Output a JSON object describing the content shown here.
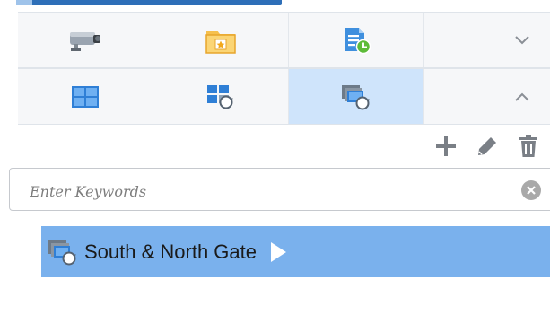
{
  "toolbar": {
    "row1": [
      "camera-icon",
      "favorites-folder-icon",
      "schedule-doc-icon",
      "chevron-down-icon"
    ],
    "row2": [
      "grid-view-icon",
      "custom-view-icon",
      "group-view-icon",
      "chevron-up-icon"
    ],
    "active_cell": "group-view-icon"
  },
  "actions": [
    "add-icon",
    "edit-icon",
    "delete-icon"
  ],
  "search": {
    "placeholder": "Enter Keywords",
    "value": ""
  },
  "tree": {
    "items": [
      {
        "label": "South & North Gate",
        "selected": true
      }
    ]
  },
  "colors": {
    "selected_bg": "#7ab1ed",
    "active_cell_bg": "#cfe4fb",
    "accent": "#2e6fb8"
  }
}
